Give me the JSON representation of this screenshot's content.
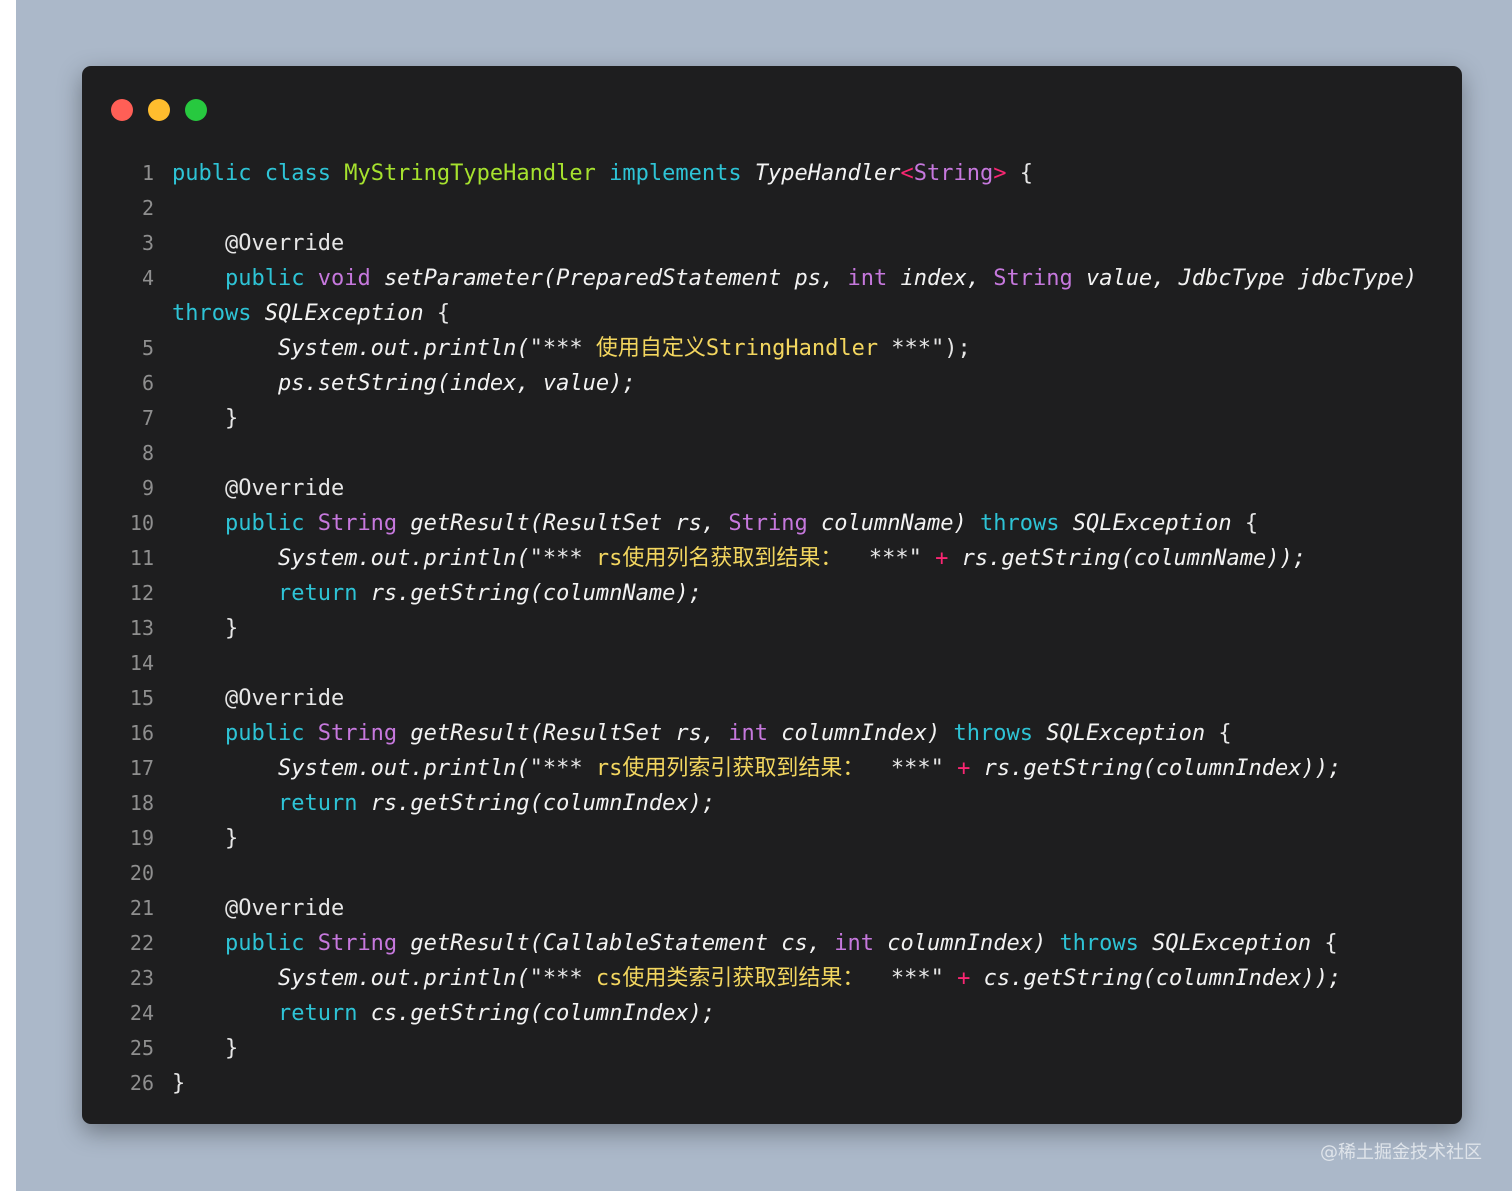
{
  "window": {
    "controls": [
      "close",
      "minimize",
      "maximize"
    ]
  },
  "watermark": "@稀土掘金技术社区",
  "code": {
    "language": "java",
    "lines": [
      {
        "n": "1",
        "tokens": [
          [
            "kw",
            "public "
          ],
          [
            "kw",
            "class "
          ],
          [
            "cls",
            "MyStringTypeHandler "
          ],
          [
            "kw",
            "implements "
          ],
          [
            "ital",
            "TypeHandler"
          ],
          [
            "op",
            "<"
          ],
          [
            "ty",
            "String"
          ],
          [
            "op",
            "> "
          ],
          [
            "plain",
            "{"
          ]
        ]
      },
      {
        "n": "2",
        "tokens": []
      },
      {
        "n": "3",
        "tokens": [
          [
            "plain",
            "    @Override"
          ]
        ]
      },
      {
        "n": "4",
        "tokens": [
          [
            "plain",
            "    "
          ],
          [
            "kw",
            "public "
          ],
          [
            "ty",
            "void "
          ],
          [
            "ital",
            "setParameter(PreparedStatement ps, "
          ],
          [
            "ty",
            "int "
          ],
          [
            "ital",
            "index, "
          ],
          [
            "ty",
            "String "
          ],
          [
            "ital",
            "value, JdbcType jdbcType)"
          ]
        ]
      },
      {
        "n": "",
        "tokens": [
          [
            "kw",
            "throws "
          ],
          [
            "ital",
            "SQLException "
          ],
          [
            "plain",
            "{"
          ]
        ]
      },
      {
        "n": "5",
        "tokens": [
          [
            "plain",
            "        "
          ],
          [
            "ital",
            "System.out.println("
          ],
          [
            "plain",
            "\"*** "
          ],
          [
            "str",
            "使用自定义StringHandler"
          ],
          [
            "plain",
            " ***\");"
          ]
        ]
      },
      {
        "n": "6",
        "tokens": [
          [
            "plain",
            "        "
          ],
          [
            "ital",
            "ps.setString(index, value);"
          ]
        ]
      },
      {
        "n": "7",
        "tokens": [
          [
            "plain",
            "    }"
          ]
        ]
      },
      {
        "n": "8",
        "tokens": []
      },
      {
        "n": "9",
        "tokens": [
          [
            "plain",
            "    @Override"
          ]
        ]
      },
      {
        "n": "10",
        "tokens": [
          [
            "plain",
            "    "
          ],
          [
            "kw",
            "public "
          ],
          [
            "ty",
            "String "
          ],
          [
            "ital",
            "getResult(ResultSet rs, "
          ],
          [
            "ty",
            "String "
          ],
          [
            "ital",
            "columnName) "
          ],
          [
            "kw",
            "throws "
          ],
          [
            "ital",
            "SQLException "
          ],
          [
            "plain",
            "{"
          ]
        ]
      },
      {
        "n": "11",
        "tokens": [
          [
            "plain",
            "        "
          ],
          [
            "ital",
            "System.out.println("
          ],
          [
            "plain",
            "\"*** "
          ],
          [
            "str",
            "rs使用列名获取到结果："
          ],
          [
            "plain",
            "  ***\" "
          ],
          [
            "op",
            "+ "
          ],
          [
            "ital",
            "rs.getString(columnName));"
          ]
        ]
      },
      {
        "n": "12",
        "tokens": [
          [
            "plain",
            "        "
          ],
          [
            "kw",
            "return "
          ],
          [
            "ital",
            "rs.getString(columnName);"
          ]
        ]
      },
      {
        "n": "13",
        "tokens": [
          [
            "plain",
            "    }"
          ]
        ]
      },
      {
        "n": "14",
        "tokens": []
      },
      {
        "n": "15",
        "tokens": [
          [
            "plain",
            "    @Override"
          ]
        ]
      },
      {
        "n": "16",
        "tokens": [
          [
            "plain",
            "    "
          ],
          [
            "kw",
            "public "
          ],
          [
            "ty",
            "String "
          ],
          [
            "ital",
            "getResult(ResultSet rs, "
          ],
          [
            "ty",
            "int "
          ],
          [
            "ital",
            "columnIndex) "
          ],
          [
            "kw",
            "throws "
          ],
          [
            "ital",
            "SQLException "
          ],
          [
            "plain",
            "{"
          ]
        ]
      },
      {
        "n": "17",
        "tokens": [
          [
            "plain",
            "        "
          ],
          [
            "ital",
            "System.out.println("
          ],
          [
            "plain",
            "\"*** "
          ],
          [
            "str",
            "rs使用列索引获取到结果："
          ],
          [
            "plain",
            "  ***\" "
          ],
          [
            "op",
            "+ "
          ],
          [
            "ital",
            "rs.getString(columnIndex));"
          ]
        ]
      },
      {
        "n": "18",
        "tokens": [
          [
            "plain",
            "        "
          ],
          [
            "kw",
            "return "
          ],
          [
            "ital",
            "rs.getString(columnIndex);"
          ]
        ]
      },
      {
        "n": "19",
        "tokens": [
          [
            "plain",
            "    }"
          ]
        ]
      },
      {
        "n": "20",
        "tokens": []
      },
      {
        "n": "21",
        "tokens": [
          [
            "plain",
            "    @Override"
          ]
        ]
      },
      {
        "n": "22",
        "tokens": [
          [
            "plain",
            "    "
          ],
          [
            "kw",
            "public "
          ],
          [
            "ty",
            "String "
          ],
          [
            "ital",
            "getResult(CallableStatement cs, "
          ],
          [
            "ty",
            "int "
          ],
          [
            "ital",
            "columnIndex) "
          ],
          [
            "kw",
            "throws "
          ],
          [
            "ital",
            "SQLException "
          ],
          [
            "plain",
            "{"
          ]
        ]
      },
      {
        "n": "23",
        "tokens": [
          [
            "plain",
            "        "
          ],
          [
            "ital",
            "System.out.println("
          ],
          [
            "plain",
            "\"*** "
          ],
          [
            "str",
            "cs使用类索引获取到结果："
          ],
          [
            "plain",
            "  ***\" "
          ],
          [
            "op",
            "+ "
          ],
          [
            "ital",
            "cs.getString(columnIndex));"
          ]
        ]
      },
      {
        "n": "24",
        "tokens": [
          [
            "plain",
            "        "
          ],
          [
            "kw",
            "return "
          ],
          [
            "ital",
            "cs.getString(columnIndex);"
          ]
        ]
      },
      {
        "n": "25",
        "tokens": [
          [
            "plain",
            "    }"
          ]
        ]
      },
      {
        "n": "26",
        "tokens": [
          [
            "plain",
            "}"
          ]
        ]
      }
    ]
  }
}
